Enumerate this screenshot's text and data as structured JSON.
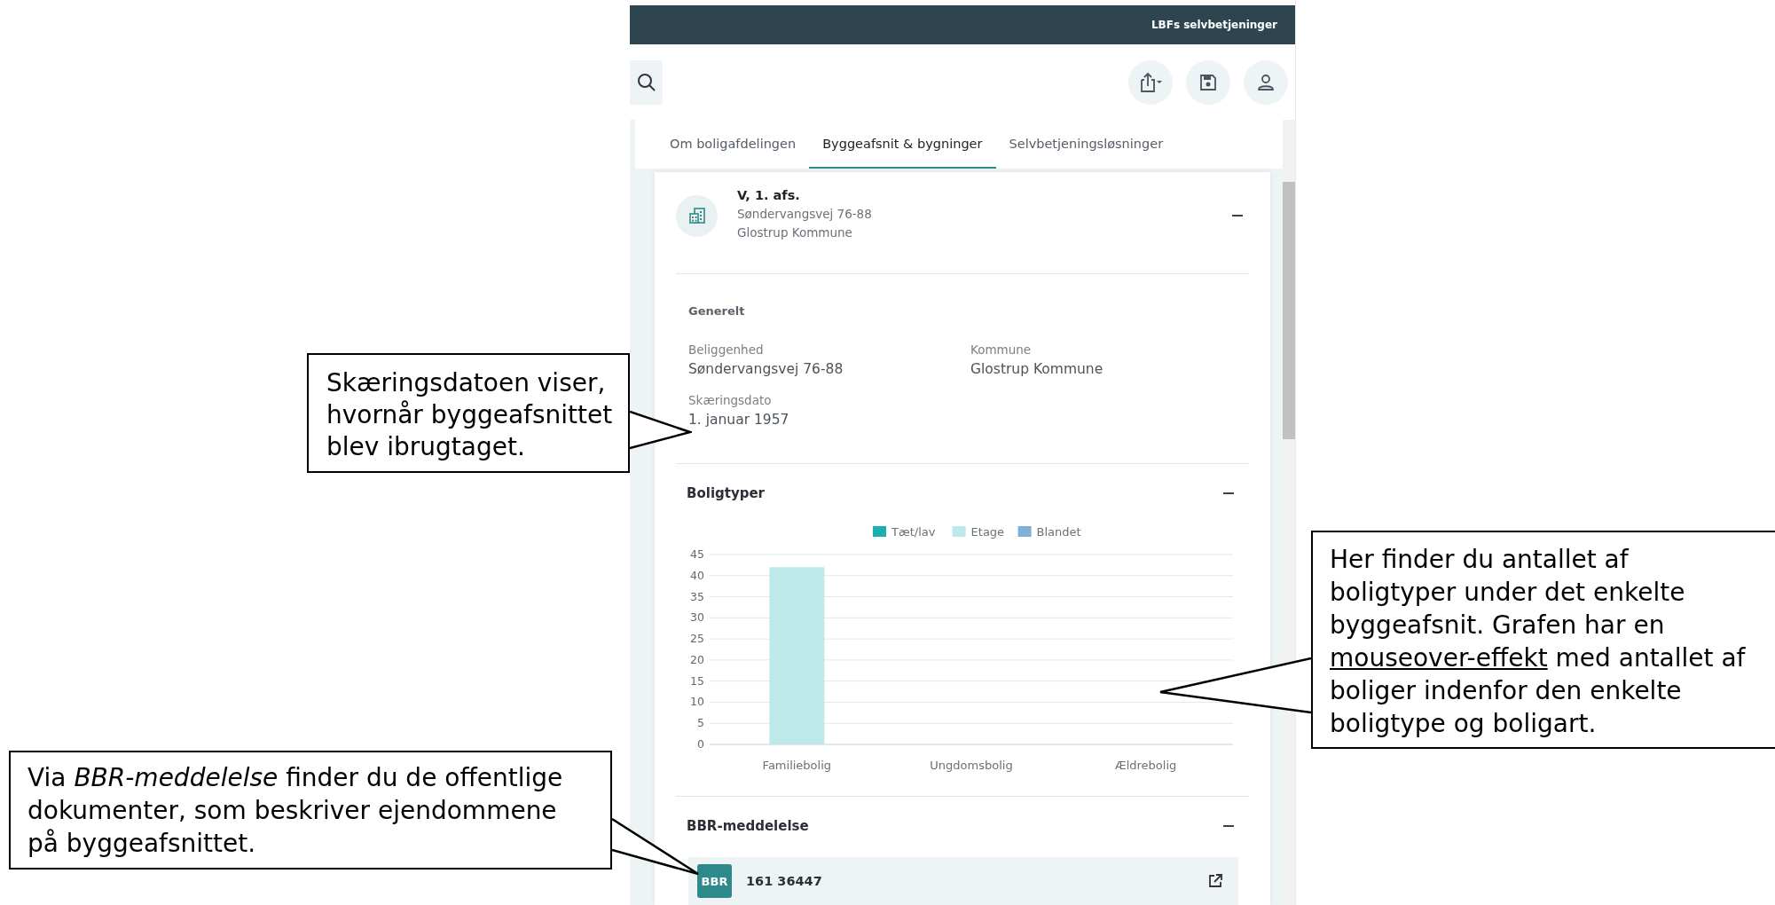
{
  "top_bar": {
    "title": "LBFs selvbetjeninger"
  },
  "tabs": [
    {
      "label": "Om boligafdelingen",
      "selected": false
    },
    {
      "label": "Byggeafsnit & bygninger",
      "selected": true
    },
    {
      "label": "Selvbetjeningsløsninger",
      "selected": false
    }
  ],
  "section": {
    "title": "V, 1. afs.",
    "address": "Søndervangsvej 76-88",
    "municipality": "Glostrup Kommune",
    "expanded": true
  },
  "general": {
    "heading": "Generelt",
    "fields": [
      {
        "label": "Beliggenhed",
        "value": "Søndervangsvej 76-88"
      },
      {
        "label": "Kommune",
        "value": "Glostrup Kommune"
      },
      {
        "label": "Skæringsdato",
        "value": "1. januar 1957"
      }
    ]
  },
  "housing_types": {
    "heading": "Boligtyper",
    "expanded": true,
    "chart_data": {
      "type": "bar",
      "categories": [
        "Familiebolig",
        "Ungdomsbolig",
        "Ældrebolig"
      ],
      "stacked": true,
      "grid": true,
      "ylim": [
        0,
        45
      ],
      "yticks": [
        0,
        5,
        10,
        15,
        20,
        25,
        30,
        35,
        40,
        45
      ],
      "series": [
        {
          "name": "Tæt/lav",
          "color": "#1aafb0",
          "values": [
            0,
            0,
            0
          ]
        },
        {
          "name": "Etage",
          "color": "#bde9ea",
          "values": [
            42,
            0,
            0
          ]
        },
        {
          "name": "Blandet",
          "color": "#7fb0d8",
          "values": [
            0,
            0,
            0
          ]
        }
      ]
    }
  },
  "bbr": {
    "heading": "BBR-meddelelse",
    "expanded": true,
    "items": [
      {
        "badge": "BBR",
        "number": "161 36447"
      }
    ]
  },
  "callouts": [
    {
      "parts": [
        {
          "kind": "plain",
          "text": "Skæringsdatoen viser,\nhvornår byggeafsnittet\nblev ibrugtaget."
        }
      ]
    },
    {
      "parts": [
        {
          "kind": "plain",
          "text": "Her finder du antallet af\nboligtyper under det enkelte\nbyggeafsnit. Grafen har en\n"
        },
        {
          "kind": "link",
          "text": "mouseover-effekt"
        },
        {
          "kind": "plain",
          "text": " med antallet af\nboliger indenfor den enkelte\nboligtype og boligart."
        }
      ]
    },
    {
      "parts": [
        {
          "kind": "rich",
          "text": "Via *BBR-meddelelse* finder du de offentlige\ndokumenter, som beskriver ejendommene\npå byggeafsnittet."
        }
      ]
    }
  ]
}
